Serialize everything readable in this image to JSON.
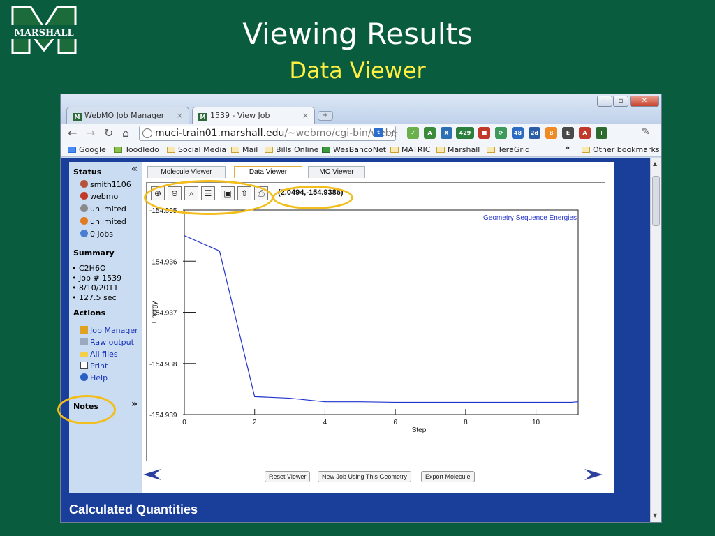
{
  "slide": {
    "logo_text": "MARSHALL",
    "title": "Viewing Results",
    "subtitle": "Data Viewer"
  },
  "browser": {
    "tabs": [
      {
        "label": "WebMO Job Manager",
        "active": false
      },
      {
        "label": "1539 - View Job",
        "active": true
      }
    ],
    "url_host": "muci-train01.marshall.edu",
    "url_path": "/~webmo/cgi-bin/webmo",
    "extension_badges": [
      "429",
      "48",
      "2d"
    ],
    "bookmarks": [
      "Google",
      "Toodledo",
      "Social Media",
      "Mail",
      "Bills Online",
      "WesBancoNet",
      "MATRIC",
      "Marshall",
      "TeraGrid"
    ],
    "more_bookmarks": "»",
    "other_bookmarks": "Other bookmarks"
  },
  "sidebar": {
    "status_heading": "Status",
    "status_items": [
      "smith1106",
      "webmo",
      "unlimited",
      "unlimited",
      "0 jobs"
    ],
    "summary_heading": "Summary",
    "summary_items": [
      "C2H6O",
      "Job # 1539",
      "8/10/2011",
      "127.5 sec"
    ],
    "actions_heading": "Actions",
    "actions": [
      "Job Manager",
      "Raw output",
      "All files",
      "Print",
      "Help"
    ],
    "notes_heading": "Notes",
    "collapse_symbol": "«",
    "expand_symbol": "»"
  },
  "viewer": {
    "tabs": [
      "Molecule Viewer",
      "Data Viewer",
      "MO Viewer"
    ],
    "active_tab": "Data Viewer",
    "coordinate_readout": "(2.0494,-154.9386)",
    "buttons": [
      "Reset Viewer",
      "New Job Using This Geometry",
      "Export Molecule"
    ]
  },
  "chart_data": {
    "type": "line",
    "title": "Geometry Sequence Energies",
    "xlabel": "Step",
    "ylabel": "Energy",
    "xlim": [
      0,
      11.2
    ],
    "ylim": [
      -154.939,
      -154.935
    ],
    "xticks": [
      0,
      2,
      4,
      6,
      8,
      10
    ],
    "yticks": [
      -154.935,
      -154.936,
      -154.937,
      -154.938,
      -154.939
    ],
    "ytick_labels": [
      "-154.935",
      "-154.936",
      "-154.937",
      "-154.938",
      "-154.939"
    ],
    "series": [
      {
        "color": "#2233cc",
        "x": [
          0,
          1,
          2,
          3,
          4,
          5,
          6,
          7,
          8,
          9,
          10,
          11,
          11.2
        ],
        "y": [
          -154.9355,
          -154.9358,
          -154.93865,
          -154.93868,
          -154.93875,
          -154.93875,
          -154.93876,
          -154.93876,
          -154.93876,
          -154.93876,
          -154.93876,
          -154.93876,
          -154.93875
        ]
      }
    ],
    "grid": false
  },
  "page": {
    "section_heading": "Calculated Quantities"
  },
  "colors": {
    "slide_background": "#0a5c3f",
    "title": "#ffffff",
    "subtitle": "#ffef40",
    "highlight": "#f2be1e",
    "page_background": "#1a3f9a",
    "sidebar": "#c9dcf2"
  }
}
